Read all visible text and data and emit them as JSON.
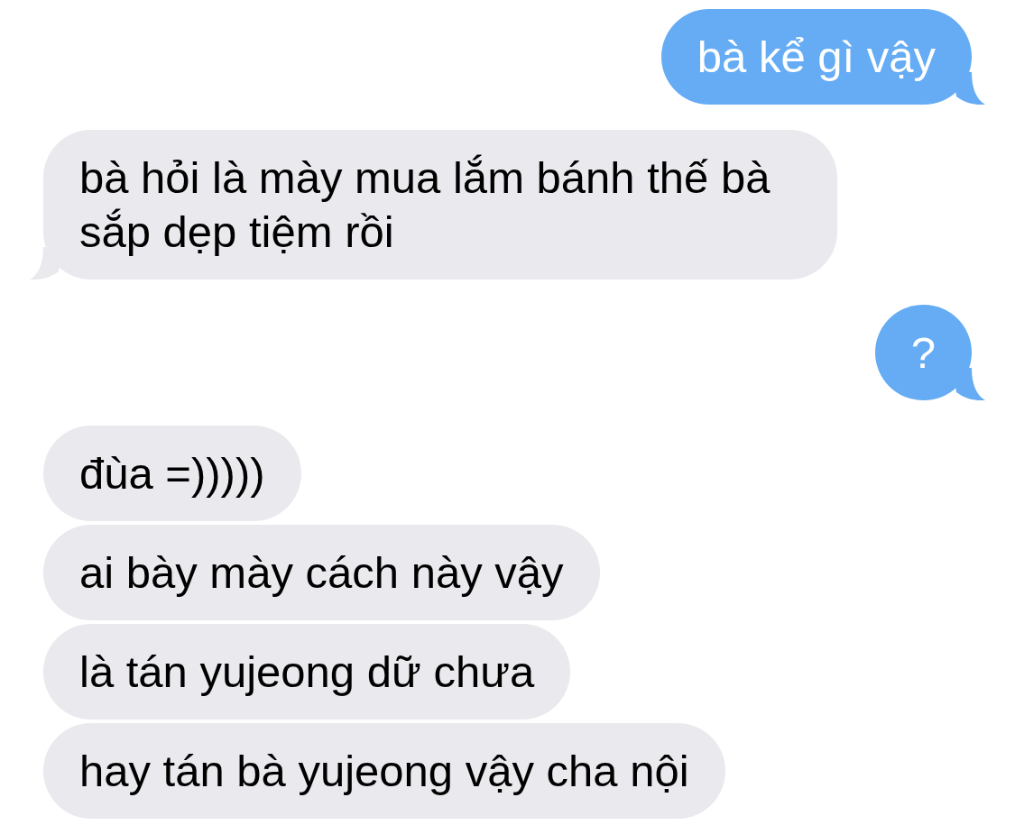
{
  "messages": [
    {
      "kind": "sent",
      "text": "bà kể gì vậy",
      "tail": true
    },
    {
      "kind": "received",
      "text": "bà hỏi là mày mua lắm bánh thế bà sắp dẹp tiệm rồi",
      "tail": true
    },
    {
      "kind": "sent",
      "text": "?",
      "tail": true
    },
    {
      "kind": "received",
      "text": "đùa =)))))",
      "tail": false
    },
    {
      "kind": "received",
      "text": "ai bày mày cách này vậy",
      "tail": false
    },
    {
      "kind": "received",
      "text": "là tán yujeong dữ chưa",
      "tail": false
    },
    {
      "kind": "received",
      "text": "hay tán bà yujeong vậy cha nội",
      "tail": false
    }
  ]
}
